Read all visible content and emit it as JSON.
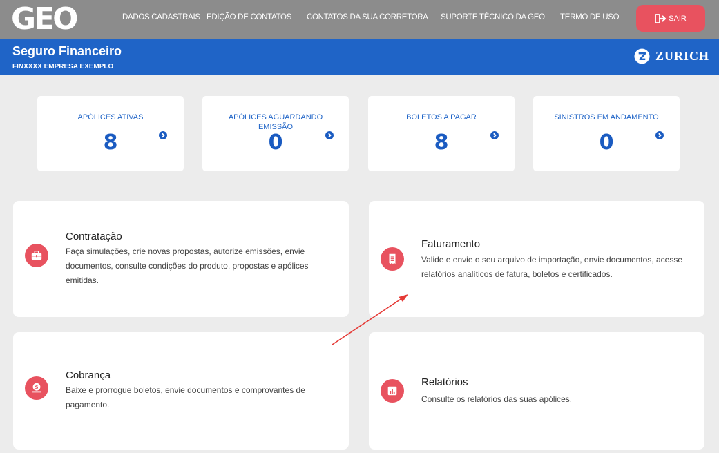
{
  "header": {
    "logo": "GEO",
    "nav": [
      {
        "label": "DADOS CADASTRAIS"
      },
      {
        "label": "EDIÇÃO DE CONTATOS"
      },
      {
        "label": "CONTATOS DA SUA CORRETORA"
      },
      {
        "label": "SUPORTE TÉCNICO DA GEO"
      },
      {
        "label": "TERMO DE USO"
      }
    ],
    "logout_label": "SAIR"
  },
  "product": {
    "title": "Seguro Financeiro",
    "company": "FINXXXX EMPRESA EXEMPLO",
    "insurer": "ZURICH"
  },
  "stats": [
    {
      "label": "APÓLICES ATIVAS",
      "value": "8"
    },
    {
      "label": "APÓLICES AGUARDANDO EMISSÃO",
      "value": "0"
    },
    {
      "label": "BOLETOS A PAGAR",
      "value": "8"
    },
    {
      "label": "SINISTROS EM ANDAMENTO",
      "value": "0"
    }
  ],
  "cards": [
    {
      "title": "Contratação",
      "icon": "briefcase-icon",
      "desc": "Faça simulações, crie novas propostas, autorize emissões, envie documentos, consulte condições do produto, propostas e apólices emitidas."
    },
    {
      "title": "Faturamento",
      "icon": "receipt-icon",
      "desc": "Valide e envie o seu arquivo de importação, envie documentos, acesse relatórios analíticos de fatura, boletos e certificados."
    },
    {
      "title": "Cobrança",
      "icon": "money-icon",
      "desc": "Baixe e prorrogue boletos, envie documentos e comprovantes de pagamento."
    },
    {
      "title": "Relatórios",
      "icon": "bar-chart-icon",
      "desc": "Consulte os relatórios das suas apólices."
    }
  ],
  "colors": {
    "nav_bg": "#8c8c8c",
    "brand_blue": "#1f64c7",
    "accent_red": "#e8525f",
    "page_bg": "#ececec",
    "annotation_arrow": "#e53935"
  }
}
